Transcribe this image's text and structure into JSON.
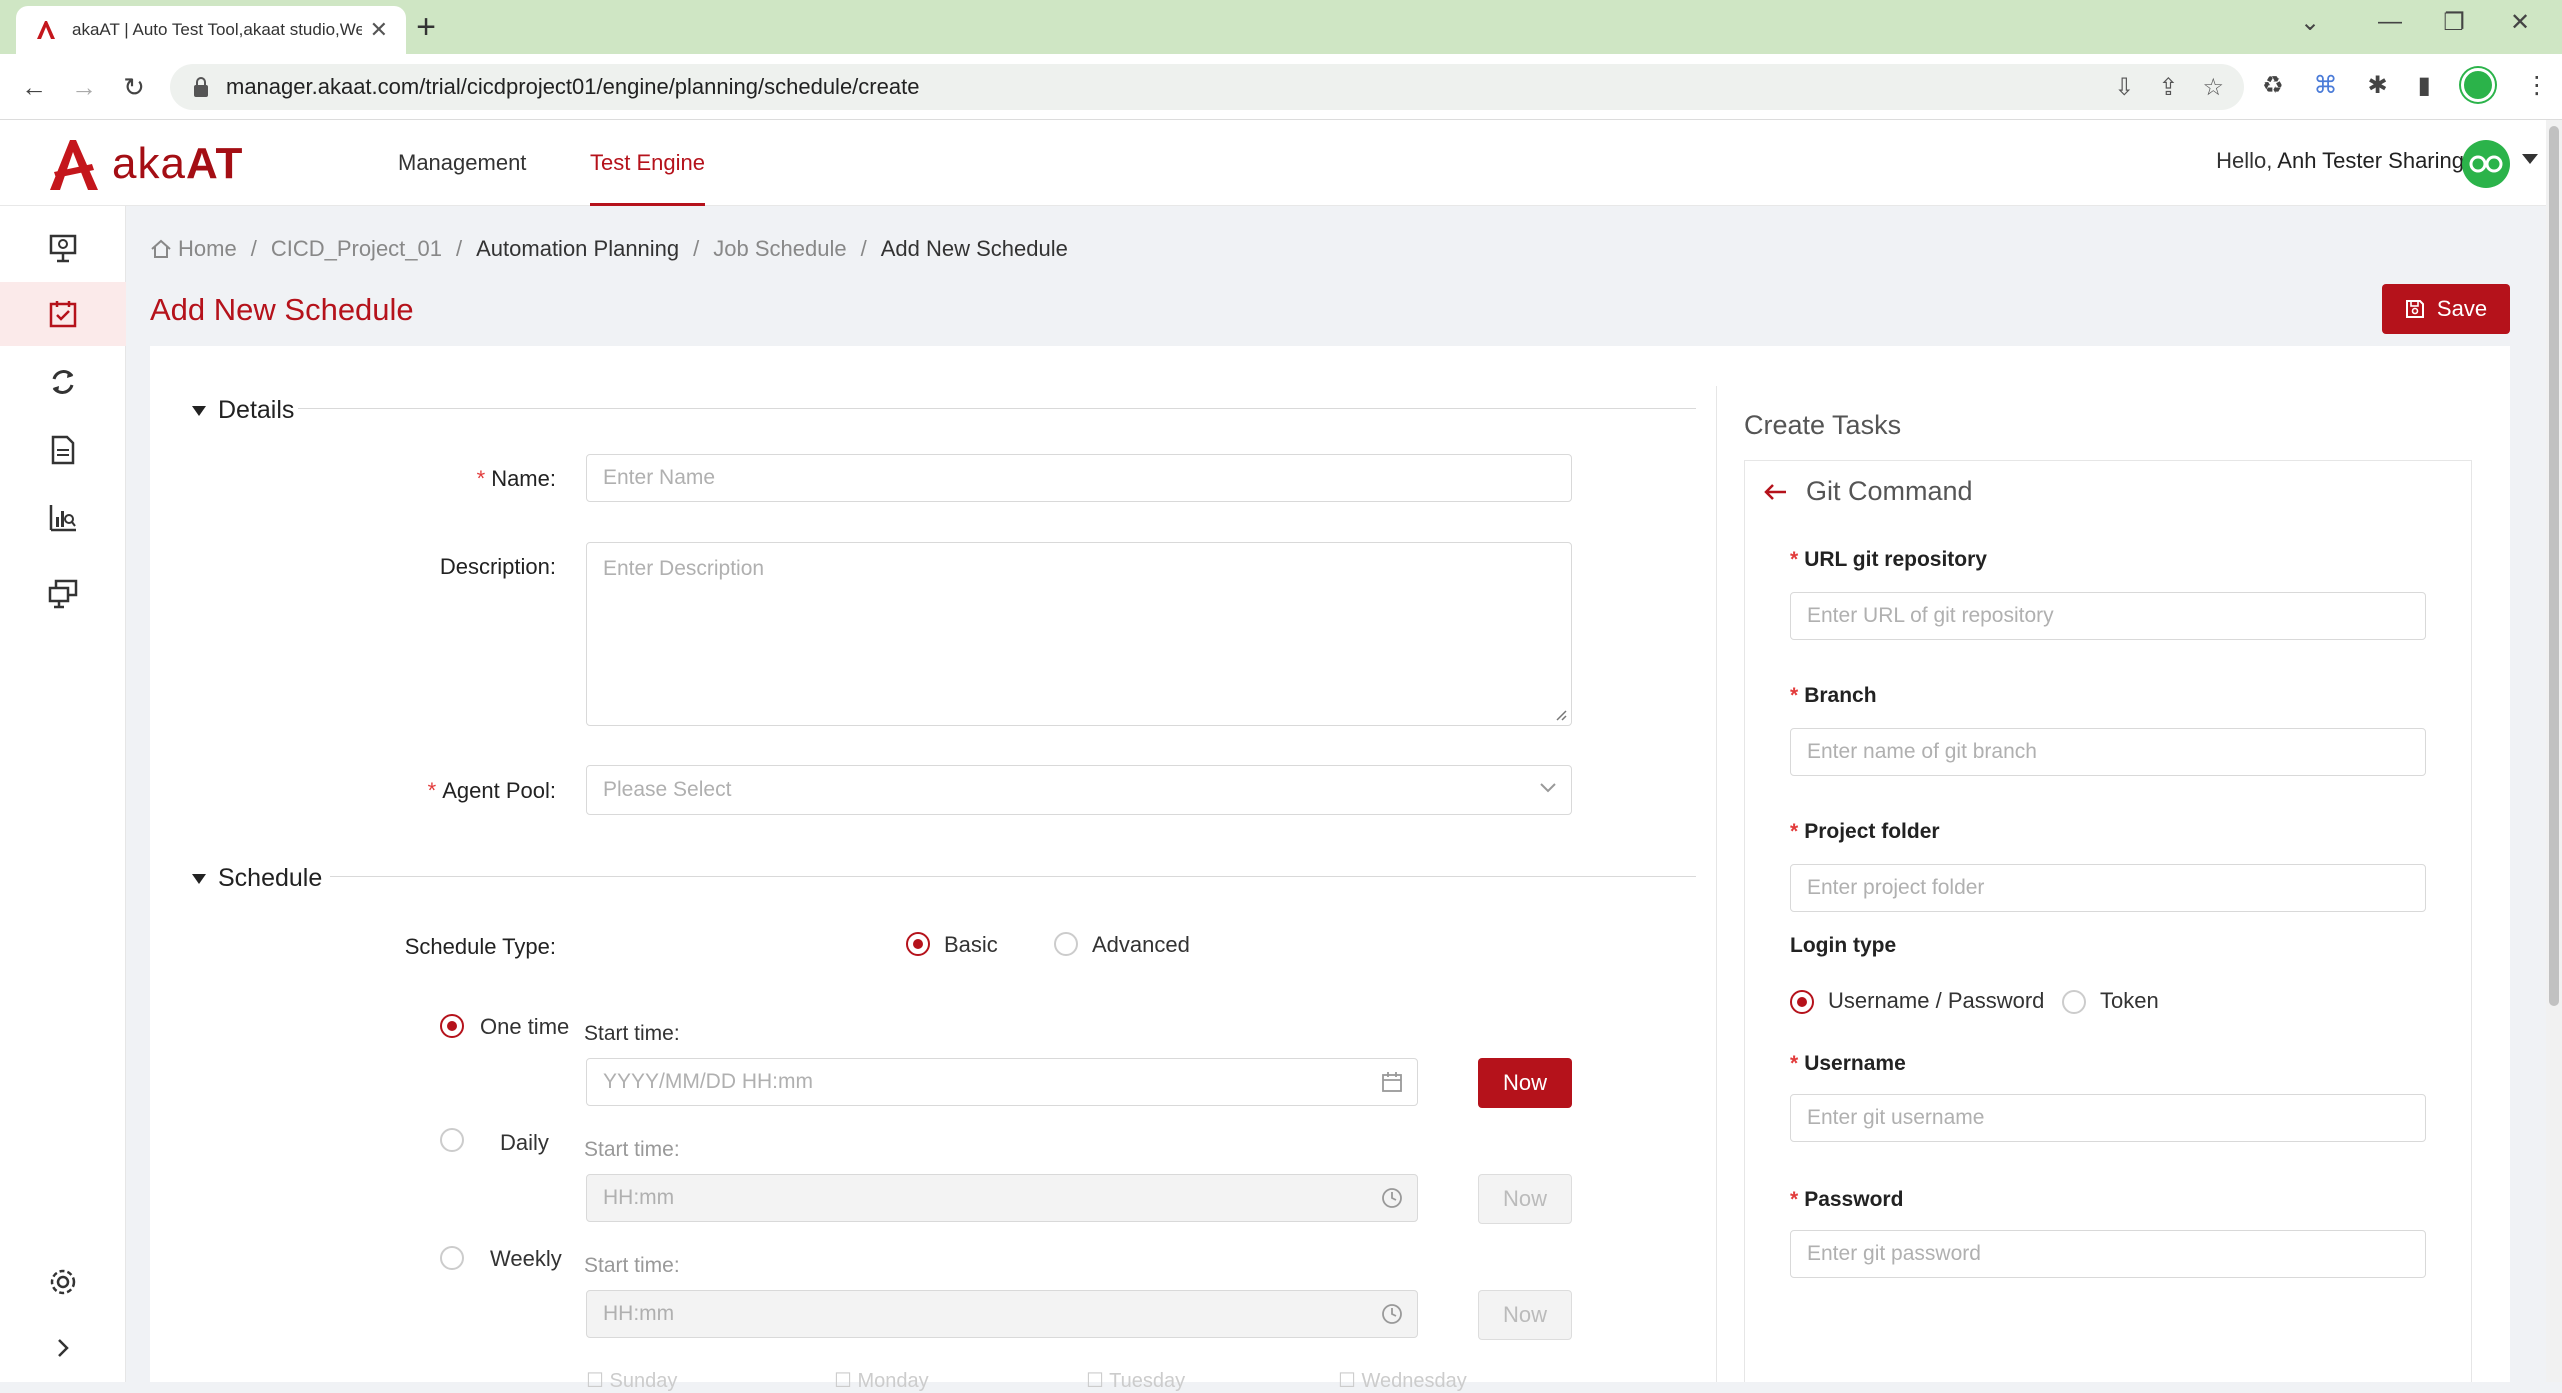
{
  "browser": {
    "tab_title": "akaAT | Auto Test Tool,akaat studio,Web",
    "url": "manager.akaat.com/trial/cicdproject01/engine/planning/schedule/create"
  },
  "header": {
    "logo_text_light": "aka",
    "logo_text_bold": "AT",
    "nav": [
      {
        "label": "Management"
      },
      {
        "label": "Test Engine"
      }
    ],
    "greeting": "Hello,",
    "user_name": "Anh Tester Sharing"
  },
  "breadcrumb": [
    "Home",
    "CICD_Project_01",
    "Automation Planning",
    "Job Schedule",
    "Add New Schedule"
  ],
  "page": {
    "title": "Add New Schedule",
    "save_label": "Save"
  },
  "details": {
    "heading": "Details",
    "name_label": "Name",
    "name_placeholder": "Enter Name",
    "description_label": "Description",
    "description_placeholder": "Enter Description",
    "agent_pool_label": "Agent Pool",
    "agent_pool_placeholder": "Please Select"
  },
  "schedule": {
    "heading": "Schedule",
    "type_label": "Schedule Type",
    "type_options": [
      "Basic",
      "Advanced"
    ],
    "type_selected": "Basic",
    "modes": [
      {
        "label": "One time",
        "start_label": "Start time",
        "placeholder": "YYYY/MM/DD HH:mm",
        "now": "Now",
        "selected": true
      },
      {
        "label": "Daily",
        "start_label": "Start time",
        "placeholder": "HH:mm",
        "now": "Now",
        "selected": false
      },
      {
        "label": "Weekly",
        "start_label": "Start time",
        "placeholder": "HH:mm",
        "now": "Now",
        "selected": false
      }
    ],
    "weekdays": [
      "Sunday",
      "Monday",
      "Tuesday",
      "Wednesday"
    ]
  },
  "tasks": {
    "heading": "Create Tasks",
    "git_heading": "Git Command",
    "url_label": "URL git repository",
    "url_placeholder": "Enter URL of git repository",
    "branch_label": "Branch",
    "branch_placeholder": "Enter name of git branch",
    "folder_label": "Project folder",
    "folder_placeholder": "Enter project folder",
    "login_type_label": "Login type",
    "login_options": [
      "Username / Password",
      "Token"
    ],
    "username_label": "Username",
    "username_placeholder": "Enter git username",
    "password_label": "Password",
    "password_placeholder": "Enter git password"
  },
  "colors": {
    "brand": "#b5121b",
    "tabbar": "#cfe6c4",
    "avatar": "#2bb34a"
  }
}
